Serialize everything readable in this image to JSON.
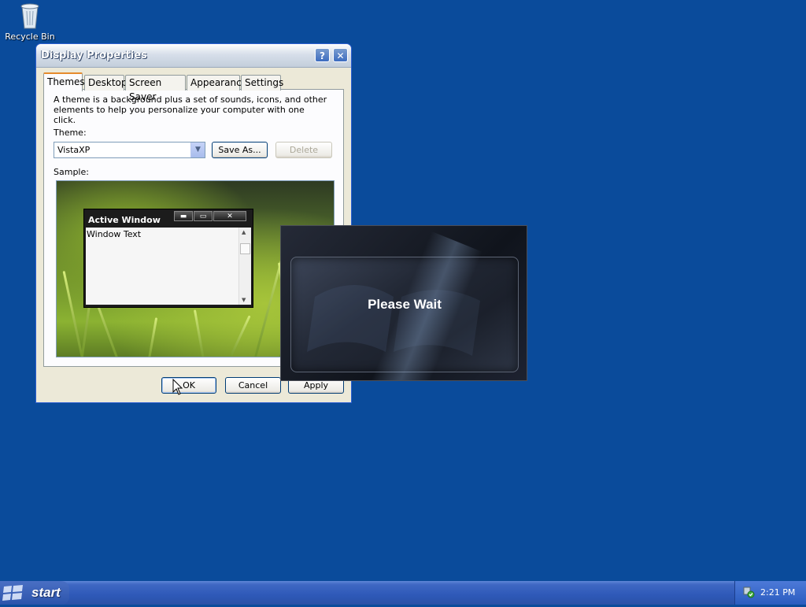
{
  "desktop": {
    "recycle_bin_label": "Recycle Bin"
  },
  "window": {
    "title": "Display Properties",
    "help_glyph": "?",
    "close_glyph": "✕",
    "tabs": [
      "Themes",
      "Desktop",
      "Screen Saver",
      "Appearance",
      "Settings"
    ],
    "active_tab": "Themes",
    "description": "A theme is a background plus a set of sounds, icons, and other elements to help you personalize your computer with one click.",
    "theme_label": "Theme:",
    "theme_value": "VistaXP",
    "save_as_label": "Save As...",
    "delete_label": "Delete",
    "sample_label": "Sample:",
    "sample_window": {
      "title": "Active Window",
      "text": "Window Text",
      "minimize_glyph": "▬",
      "maximize_glyph": "▭",
      "close_glyph": "✕"
    },
    "ok_label": "OK",
    "cancel_label": "Cancel",
    "apply_label": "Apply"
  },
  "splash": {
    "message": "Please Wait"
  },
  "taskbar": {
    "start_label": "start",
    "clock": "2:21 PM"
  }
}
